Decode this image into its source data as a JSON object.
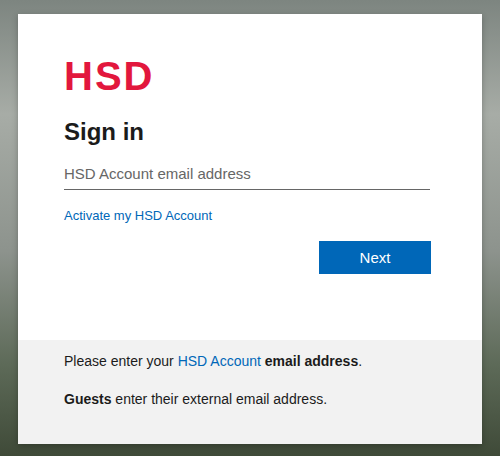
{
  "logo": "HSD",
  "title": "Sign in",
  "email_field": {
    "placeholder": "HSD Account email address",
    "value": ""
  },
  "activate_link": "Activate my HSD Account",
  "buttons": [
    "Next"
  ],
  "footer": [
    [
      {
        "text": "Please enter your ",
        "kind": "plain"
      },
      {
        "text": "HSD Account",
        "kind": "link"
      },
      {
        "text": " ",
        "kind": "plain"
      },
      {
        "text": "email address",
        "kind": "bold"
      },
      {
        "text": ".",
        "kind": "plain"
      }
    ],
    [
      {
        "text": "Guests",
        "kind": "bold"
      },
      {
        "text": " enter their external email address.",
        "kind": "plain"
      }
    ]
  ]
}
